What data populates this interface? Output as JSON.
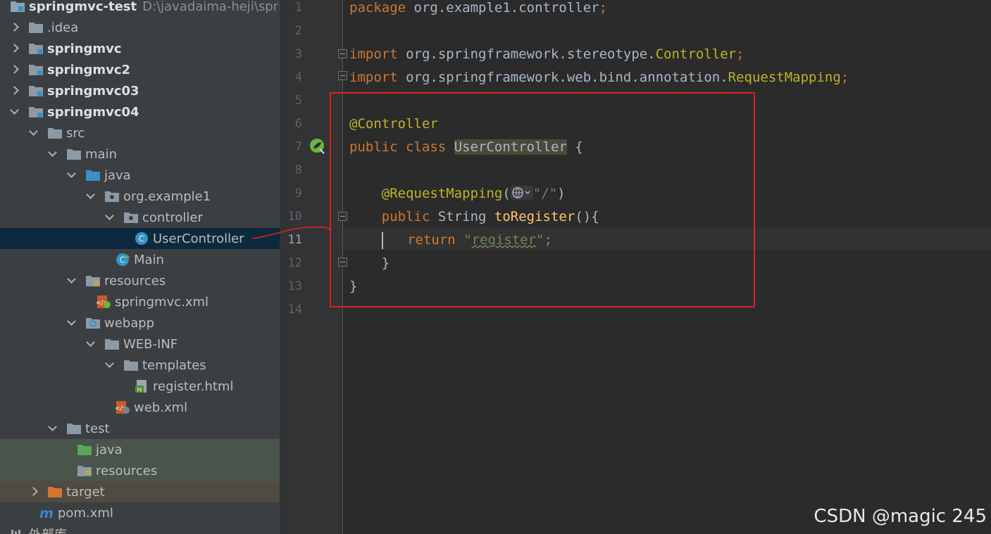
{
  "project_tree": {
    "root": {
      "name": "springmvc-test",
      "path": "D:\\javadaima-heji\\spring"
    },
    "items": [
      {
        "label": ".idea"
      },
      {
        "label": "springmvc"
      },
      {
        "label": "springmvc2"
      },
      {
        "label": "springmvc03"
      },
      {
        "label": "springmvc04"
      },
      {
        "label": "src"
      },
      {
        "label": "main"
      },
      {
        "label": "java"
      },
      {
        "label": "org.example1"
      },
      {
        "label": "controller"
      },
      {
        "label": "UserController"
      },
      {
        "label": "Main"
      },
      {
        "label": "resources"
      },
      {
        "label": "springmvc.xml"
      },
      {
        "label": "webapp"
      },
      {
        "label": "WEB-INF"
      },
      {
        "label": "templates"
      },
      {
        "label": "register.html"
      },
      {
        "label": "web.xml"
      },
      {
        "label": "test"
      },
      {
        "label": "java"
      },
      {
        "label": "resources"
      },
      {
        "label": "target"
      },
      {
        "label": "pom.xml"
      },
      {
        "label": "外部库"
      }
    ]
  },
  "editor": {
    "current_line": 11,
    "line_numbers": [
      "1",
      "2",
      "3",
      "4",
      "5",
      "6",
      "7",
      "8",
      "9",
      "10",
      "11",
      "12",
      "13",
      "14"
    ],
    "code": {
      "l1": {
        "kw": "package",
        "rest": " org.example1.controller",
        "semi": ";"
      },
      "l3": {
        "kw": "import",
        "pkg": " org.springframework.stereotype.",
        "cls": "Controller",
        "semi": ";"
      },
      "l4": {
        "kw": "import",
        "pkg": " org.springframework.web.bind.annotation.",
        "cls": "RequestMapping",
        "semi": ";"
      },
      "l6": {
        "ann": "@Controller"
      },
      "l7": {
        "kw": "public class",
        "cls": "UserController",
        "brace": " {"
      },
      "l9": {
        "ann": "@RequestMapping",
        "open": "(",
        "str": "\"/\"",
        "close": ")"
      },
      "l10": {
        "kw": "public",
        "type": " String ",
        "fn": "toRegister",
        "rest": "(){"
      },
      "l11": {
        "kw": "return",
        "q1": "\"",
        "str": "register",
        "q2": "\"",
        "semi": ";"
      },
      "l12": {
        "brace": "}"
      },
      "l13": {
        "brace": "}"
      }
    }
  },
  "watermark": "CSDN @magic 245",
  "colors": {
    "keyword": "#cc7832",
    "annotation": "#bbb529",
    "string": "#6a8759",
    "method": "#ffc66d",
    "highlight_box": "#e02020"
  }
}
